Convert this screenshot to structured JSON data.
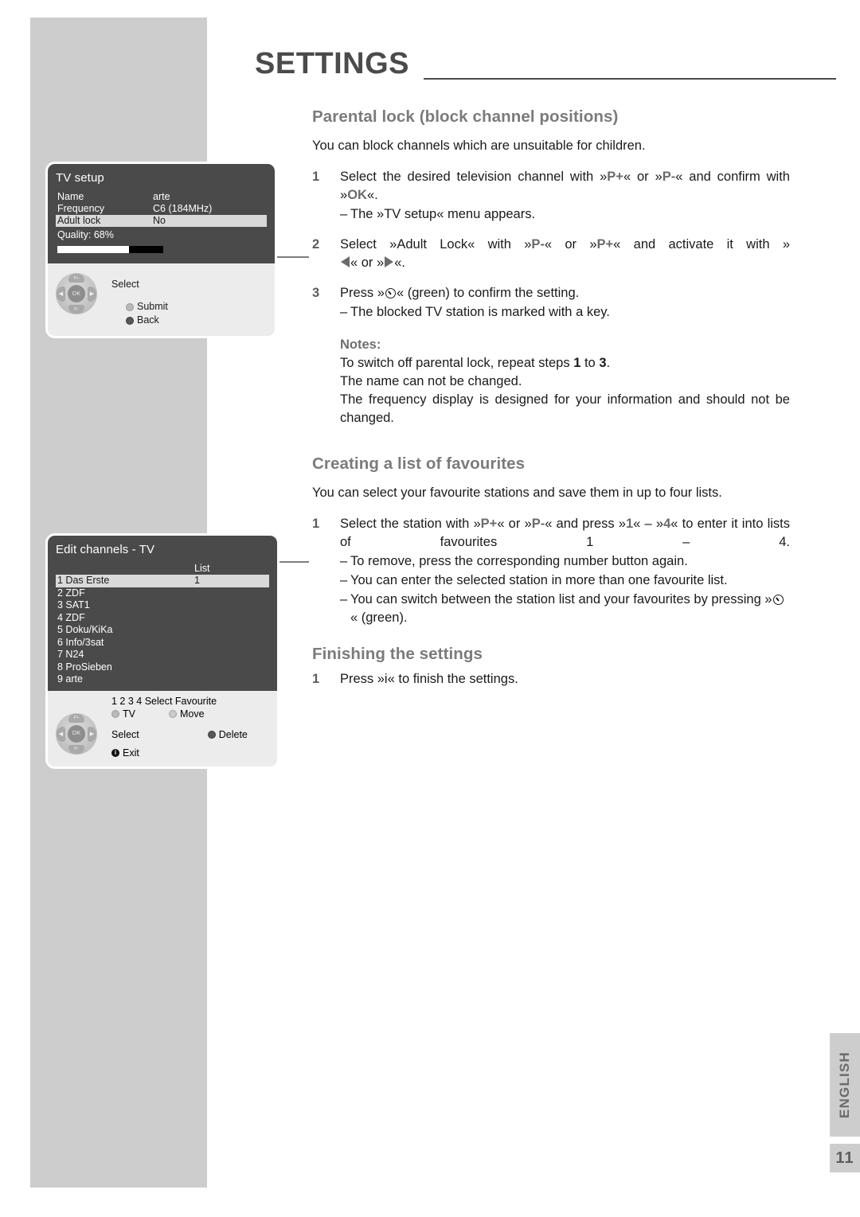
{
  "page": {
    "title": "SETTINGS",
    "language_tab": "ENGLISH",
    "page_number": "11"
  },
  "sections": {
    "parental": {
      "heading": "Parental lock (block channel positions)",
      "lead": "You can block channels which are unsuitable for children.",
      "step1_num": "1",
      "step1_a": "Select the desired television channel with »",
      "step1_kb1": "P+",
      "step1_b": "« or »",
      "step1_kb2": "P-",
      "step1_c": "« and confirm with »",
      "step1_kb3": "OK",
      "step1_d": "«.",
      "step1_sub_dash": "–",
      "step1_sub": "The »TV setup« menu appears.",
      "step2_num": "2",
      "step2_a": "Select »Adult Lock« with »",
      "step2_kb1": "P-",
      "step2_b": "« or »",
      "step2_kb2": "P+",
      "step2_c": "« and activate it with »",
      "step2_d": "« or »",
      "step2_e": "«.",
      "step3_num": "3",
      "step3_a": "Press »",
      "step3_b": "« (green) to confirm the setting.",
      "step3_sub_dash": "–",
      "step3_sub": "The blocked TV station is marked with a key.",
      "notes_head": "Notes:",
      "note1_a": "To switch off parental lock, repeat steps ",
      "note1_b": "1",
      "note1_c": " to ",
      "note1_d": "3",
      "note1_e": ".",
      "note2": "The name can not be changed.",
      "note3": "The frequency display is designed for your information and should not be changed."
    },
    "favourites": {
      "heading": "Creating a list of favourites",
      "lead": "You can select your favourite stations and save them in up to four lists.",
      "step1_num": "1",
      "step1_a": "Select the station with »",
      "step1_kb1": "P+",
      "step1_b": "« or »",
      "step1_kb2": "P-",
      "step1_c": "« and press »",
      "step1_kb3": "1",
      "step1_d": "« – »",
      "step1_kb4": "4",
      "step1_e": "« to enter it into lists of favourites 1 – 4.",
      "sub1_dash": "–",
      "sub1": "To remove, press the corresponding number button again.",
      "sub2_dash": "–",
      "sub2": "You can enter the selected station in more than one favourite list.",
      "sub3_dash": "–",
      "sub3_a": "You can switch between the station list and your favourites by pressing »",
      "sub3_b": "« (green)."
    },
    "finishing": {
      "heading": "Finishing the settings",
      "step1_num": "1",
      "step1": "Press »i« to finish the settings."
    }
  },
  "osd_tv_setup": {
    "title": "TV setup",
    "rows": [
      {
        "key": "Name",
        "value": "arte",
        "highlight": false
      },
      {
        "key": "Frequency",
        "value": "C6 (184MHz)",
        "highlight": false
      },
      {
        "key": "Adult lock",
        "value": "No",
        "highlight": true
      }
    ],
    "quality_label": "Quality: 68%",
    "quality_percent": 68,
    "footer": {
      "select_label": "Select",
      "submit_label": "Submit",
      "back_label": "Back",
      "ok_label": "OK",
      "up_label": "P+",
      "down_label": "P-"
    }
  },
  "osd_edit_channels": {
    "title": "Edit channels - TV",
    "list_header": "List",
    "channels": [
      {
        "name": "1 Das Erste",
        "list": "1",
        "selected": true
      },
      {
        "name": "2 ZDF",
        "list": "",
        "selected": false
      },
      {
        "name": "3 SAT1",
        "list": "",
        "selected": false
      },
      {
        "name": "4 ZDF",
        "list": "",
        "selected": false
      },
      {
        "name": "5 Doku/KiKa",
        "list": "",
        "selected": false
      },
      {
        "name": "6 Info/3sat",
        "list": "",
        "selected": false
      },
      {
        "name": "7 N24",
        "list": "",
        "selected": false
      },
      {
        "name": "8 ProSieben",
        "list": "",
        "selected": false
      },
      {
        "name": "9 arte",
        "list": "",
        "selected": false
      }
    ],
    "footer": {
      "select_favourite_label": "1 2 3 4 Select Favourite",
      "tv_label": "TV",
      "move_label": "Move",
      "select_label": "Select",
      "delete_label": "Delete",
      "exit_label": "Exit",
      "exit_glyph": "i",
      "ok_label": "OK",
      "up_label": "P+",
      "down_label": "P-"
    }
  },
  "colors": {
    "band": "#cdcdcd",
    "heading": "#7b7b7b",
    "title": "#4b4b4b",
    "osd_bg": "#4a4a4a",
    "osd_footer": "#ececec",
    "highlight": "#d9d9d9"
  }
}
